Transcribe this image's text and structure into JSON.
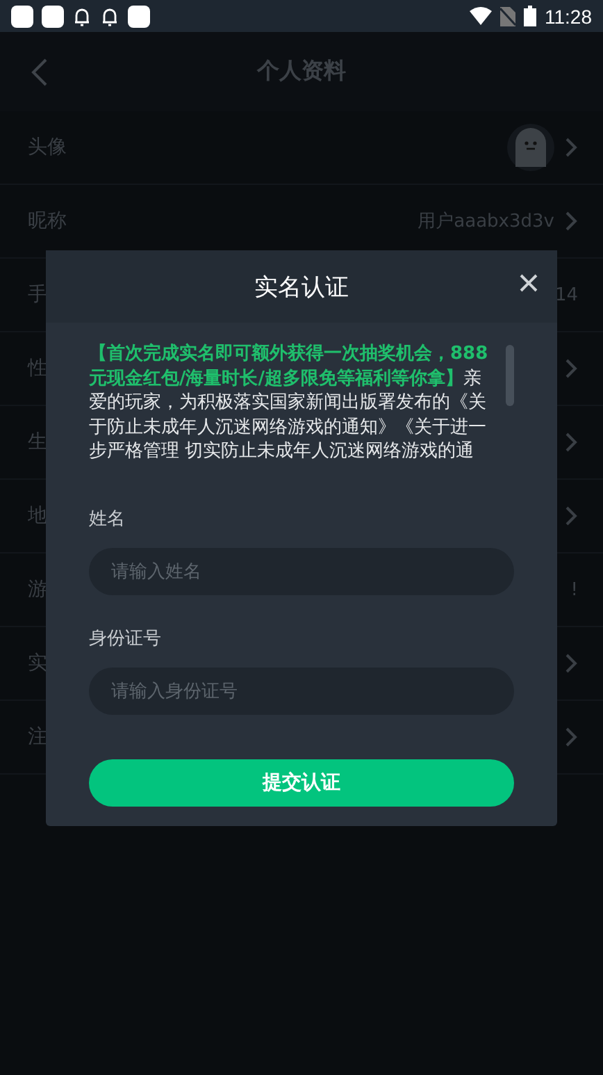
{
  "status_bar": {
    "time": "11:28"
  },
  "header": {
    "title": "个人资料"
  },
  "rows": [
    {
      "label": "头像",
      "kind": "avatar",
      "has_arrow": true
    },
    {
      "label": "昵称",
      "kind": "text",
      "value": "用户aaabx3d3v",
      "has_arrow": true
    },
    {
      "label": "手",
      "kind": "text",
      "value": "14",
      "has_arrow": false
    },
    {
      "label": "性",
      "kind": "text",
      "has_arrow": true
    },
    {
      "label": "生",
      "kind": "text",
      "has_arrow": true
    },
    {
      "label": "地",
      "kind": "text",
      "has_arrow": true
    },
    {
      "label": "游",
      "kind": "text",
      "value": "!",
      "has_arrow": false
    },
    {
      "label": "实",
      "kind": "text",
      "has_arrow": true
    },
    {
      "label": "注",
      "kind": "text",
      "has_arrow": true
    }
  ],
  "dialog": {
    "title": "实名认证",
    "notice": "**【首次完成实名即可额外获得一次抽奖机会，888元现金红包/海量时长/超多限免等福利等你拿】**亲爱的玩家，为积极落实国家新闻出版署发布的《关于防止未成年人沉迷网络游戏的通知》《关于进一步严格管理 切实防止未成年人沉迷网络游戏的通",
    "fields": [
      {
        "label": "姓名",
        "placeholder": "请输入姓名"
      },
      {
        "label": "身份证号",
        "placeholder": "请输入身份证号"
      }
    ],
    "submit": "提交认证"
  }
}
